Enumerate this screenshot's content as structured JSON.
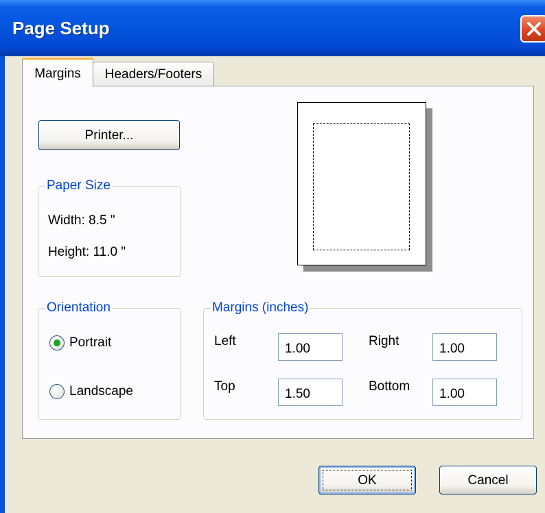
{
  "window": {
    "title": "Page Setup"
  },
  "tabs": [
    {
      "label": "Margins",
      "selected": true
    },
    {
      "label": "Headers/Footers",
      "selected": false
    }
  ],
  "printer_button": "Printer...",
  "paper_size": {
    "legend": "Paper Size",
    "width": "Width: 8.5 \"",
    "height": "Height: 11.0 \""
  },
  "orientation": {
    "legend": "Orientation",
    "options": [
      {
        "label": "Portrait",
        "selected": true
      },
      {
        "label": "Landscape",
        "selected": false
      }
    ]
  },
  "margins": {
    "legend": "Margins (inches)",
    "left_label": "Left",
    "left_value": "1.00",
    "right_label": "Right",
    "right_value": "1.00",
    "top_label": "Top",
    "top_value": "1.50",
    "bottom_label": "Bottom",
    "bottom_value": "1.00"
  },
  "buttons": {
    "ok": "OK",
    "cancel": "Cancel"
  },
  "colors": {
    "titlebar": "#0453dd",
    "legend_text": "#0046d5",
    "tab_highlight": "#f7b545",
    "close_button": "#d8431c"
  },
  "icons": {
    "close": "close-x-icon"
  }
}
